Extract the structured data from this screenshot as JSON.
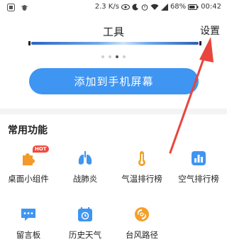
{
  "status_bar": {
    "speed": "2.3 K/s",
    "battery": "68%",
    "time": "00:42"
  },
  "header": {
    "title": "工具",
    "settings_label": "设置"
  },
  "pager": {
    "count": 4,
    "active_index": 2
  },
  "add_button_label": "添加到手机屏幕",
  "section_title": "常用功能",
  "tools": [
    {
      "label": "桌面小组件",
      "icon": "puzzle-icon",
      "badge": "HOT"
    },
    {
      "label": "战肺炎",
      "icon": "lungs-icon"
    },
    {
      "label": "气温排行榜",
      "icon": "thermometer-icon"
    },
    {
      "label": "空气排行榜",
      "icon": "air-quality-chart-icon"
    },
    {
      "label": "留言板",
      "icon": "message-board-icon"
    },
    {
      "label": "历史天气",
      "icon": "calendar-icon"
    },
    {
      "label": "台风路径",
      "icon": "typhoon-icon"
    }
  ],
  "colors": {
    "accent": "#3e95f2",
    "annotation": "#e8453c"
  }
}
